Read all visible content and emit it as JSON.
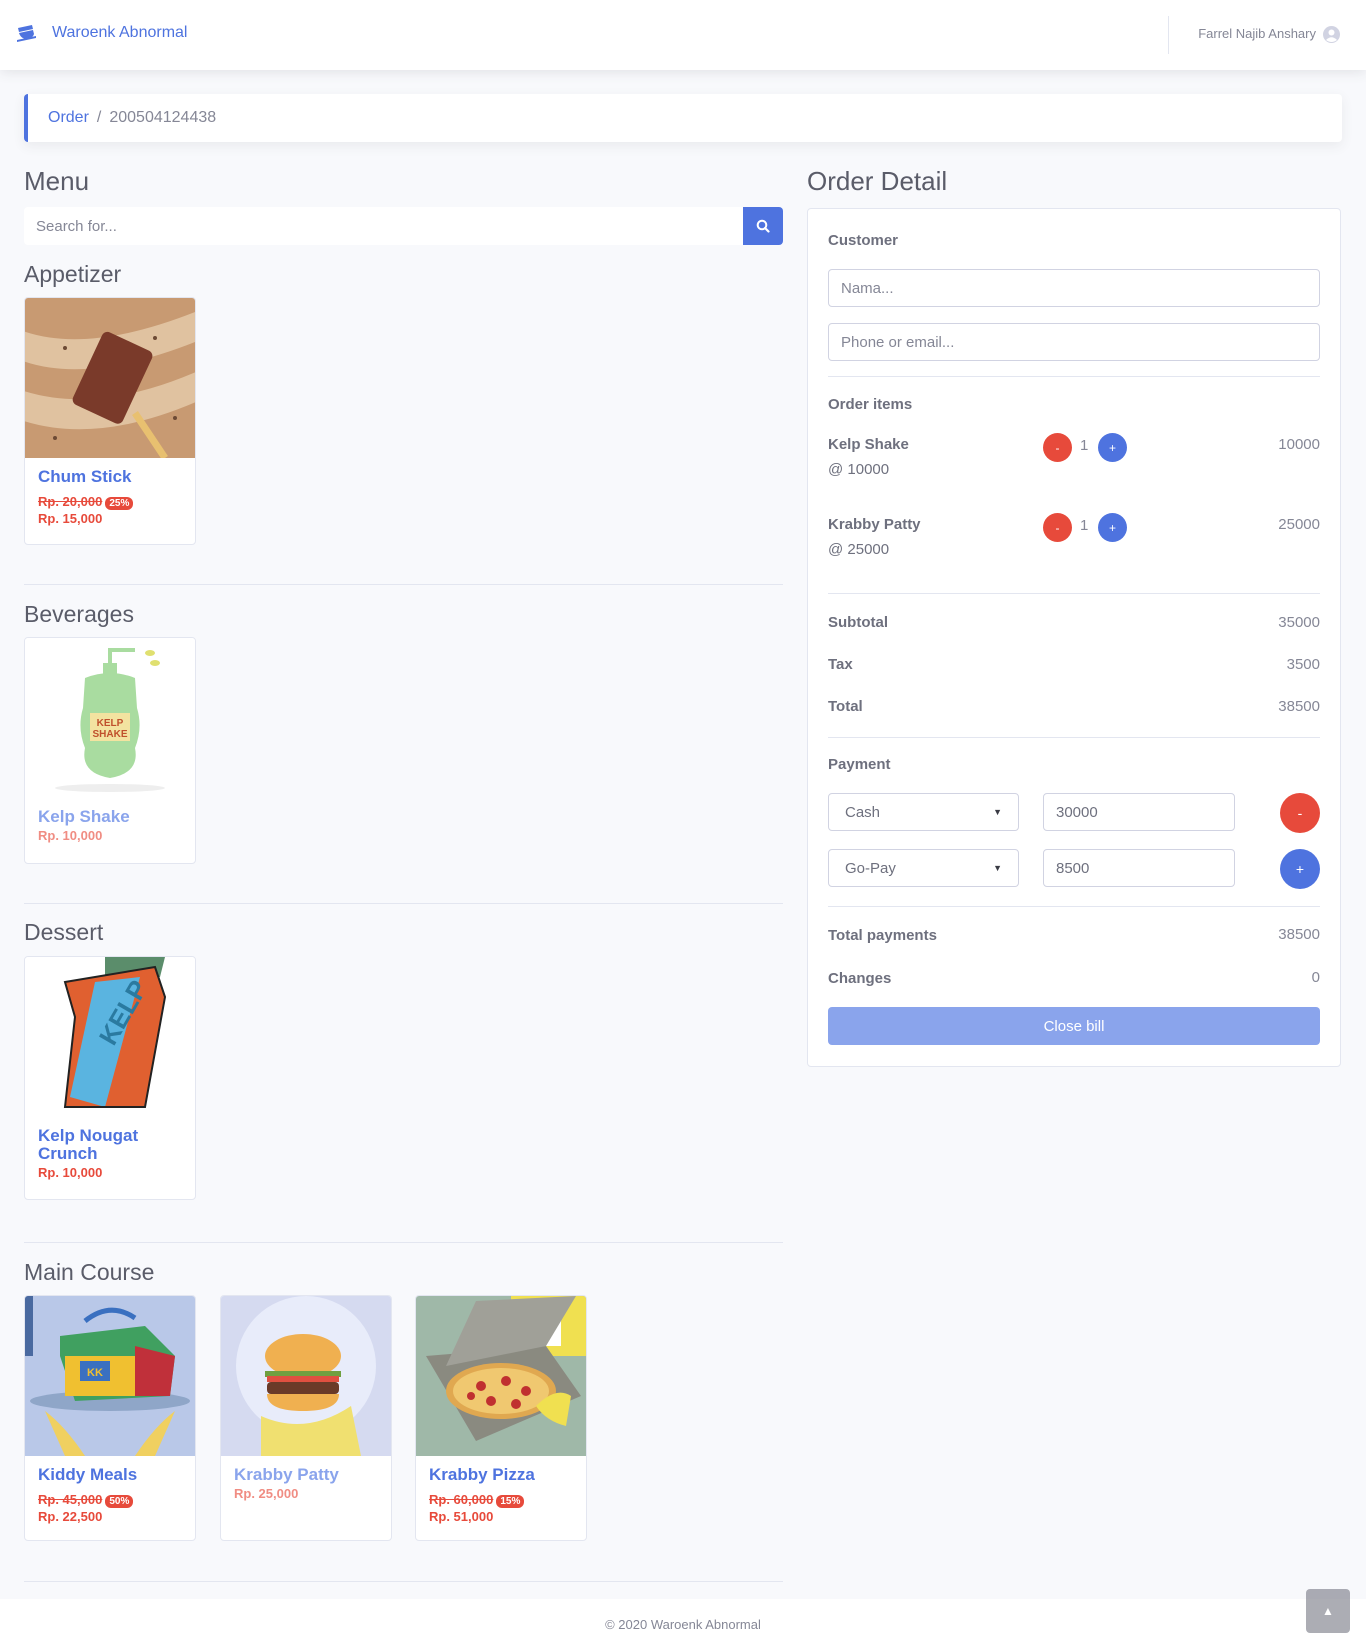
{
  "app": {
    "brand_name": "Waroenk Abnormal",
    "user_name": "Farrel Najib Anshary"
  },
  "breadcrumb": {
    "parent": "Order",
    "separator": "/",
    "current": "200504124438"
  },
  "menu": {
    "heading": "Menu",
    "search_placeholder": "Search for...",
    "categories": [
      {
        "name": "Appetizer",
        "items": [
          {
            "name": "Chum Stick",
            "old_price": "Rp. 20,000",
            "discount": "25%",
            "price": "Rp. 15,000",
            "available": true
          }
        ]
      },
      {
        "name": "Beverages",
        "items": [
          {
            "name": "Kelp Shake",
            "price": "Rp. 10,000",
            "available": false
          }
        ]
      },
      {
        "name": "Dessert",
        "items": [
          {
            "name": "Kelp Nougat Crunch",
            "price": "Rp. 10,000",
            "available": true
          }
        ]
      },
      {
        "name": "Main Course",
        "items": [
          {
            "name": "Kiddy Meals",
            "old_price": "Rp. 45,000",
            "discount": "50%",
            "price": "Rp. 22,500",
            "available": true
          },
          {
            "name": "Krabby Patty",
            "price": "Rp. 25,000",
            "available": false
          },
          {
            "name": "Krabby Pizza",
            "old_price": "Rp. 60,000",
            "discount": "15%",
            "price": "Rp. 51,000",
            "available": true
          }
        ]
      }
    ]
  },
  "order": {
    "heading": "Order Detail",
    "customer_label": "Customer",
    "name_placeholder": "Nama...",
    "contact_placeholder": "Phone or email...",
    "items_label": "Order items",
    "items": [
      {
        "name": "Kelp Shake",
        "unit": "@ 10000",
        "qty": "1",
        "amount": "10000",
        "minus": "-",
        "plus": "+"
      },
      {
        "name": "Krabby Patty",
        "unit": "@ 25000",
        "qty": "1",
        "amount": "25000",
        "minus": "-",
        "plus": "+"
      }
    ],
    "subtotal_label": "Subtotal",
    "subtotal": "35000",
    "tax_label": "Tax",
    "tax": "3500",
    "total_label": "Total",
    "total": "38500",
    "payment_label": "Payment",
    "payments": [
      {
        "method": "Cash",
        "amount": "30000",
        "action": "-"
      },
      {
        "method": "Go-Pay",
        "amount": "8500",
        "action": "+"
      }
    ],
    "total_payments_label": "Total payments",
    "total_payments": "38500",
    "changes_label": "Changes",
    "changes": "0",
    "close_bill_label": "Close bill"
  },
  "footer": {
    "copyright": "© 2020 Waroenk Abnormal"
  },
  "icons": {
    "brand": "coffee-icon",
    "user": "user-circle-icon",
    "search": "search-icon",
    "scroll_top": "chevron-up-icon"
  },
  "colors": {
    "primary": "#4e73df",
    "danger": "#e74a3b",
    "background": "#f8f9fc"
  }
}
